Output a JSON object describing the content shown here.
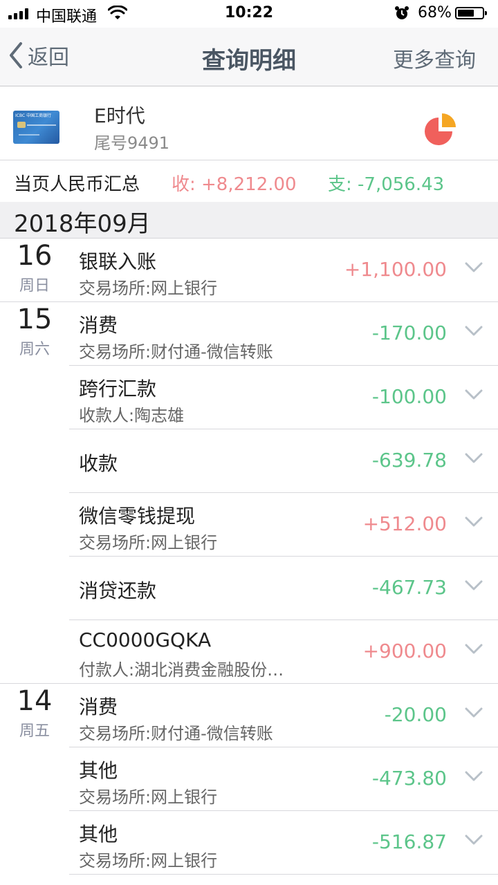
{
  "status_bar": {
    "carrier": "中国联通",
    "time": "10:22",
    "battery_percent": "68%",
    "battery_level": 0.68
  },
  "nav": {
    "back_label": "返回",
    "title": "查询明细",
    "more_label": "更多查询"
  },
  "card": {
    "name": "E时代",
    "number": "尾号9491",
    "card_brand_text": "ICBC 中国工商银行"
  },
  "summary": {
    "label": "当页人民币汇总",
    "income": "收: +8,212.00",
    "expense": "支: -7,056.43"
  },
  "month": "2018年09月",
  "colors": {
    "income": "#ef8a8e",
    "expense": "#5cc58a",
    "nav_text": "#5f6b77"
  },
  "days": [
    {
      "day": "16",
      "weekday": "周日",
      "transactions": [
        {
          "title": "银联入账",
          "subtitle": "交易场所:网上银行",
          "amount": "+1,100.00",
          "type": "in"
        }
      ]
    },
    {
      "day": "15",
      "weekday": "周六",
      "transactions": [
        {
          "title": "消费",
          "subtitle": "交易场所:财付通-微信转账",
          "amount": "-170.00",
          "type": "out"
        },
        {
          "title": "跨行汇款",
          "subtitle": "收款人:陶志雄",
          "amount": "-100.00",
          "type": "out"
        },
        {
          "title": "收款",
          "subtitle": "",
          "amount": "-639.78",
          "type": "out"
        },
        {
          "title": "微信零钱提现",
          "subtitle": "交易场所:网上银行",
          "amount": "+512.00",
          "type": "in"
        },
        {
          "title": "消贷还款",
          "subtitle": "",
          "amount": "-467.73",
          "type": "out"
        },
        {
          "title": "CC0000GQKA",
          "subtitle": "付款人:湖北消费金融股份…",
          "amount": "+900.00",
          "type": "in"
        }
      ]
    },
    {
      "day": "14",
      "weekday": "周五",
      "transactions": [
        {
          "title": "消费",
          "subtitle": "交易场所:财付通-微信转账",
          "amount": "-20.00",
          "type": "out"
        },
        {
          "title": "其他",
          "subtitle": "交易场所:网上银行",
          "amount": "-473.80",
          "type": "out"
        },
        {
          "title": "其他",
          "subtitle": "交易场所:网上银行",
          "amount": "-516.87",
          "type": "out"
        }
      ]
    }
  ]
}
